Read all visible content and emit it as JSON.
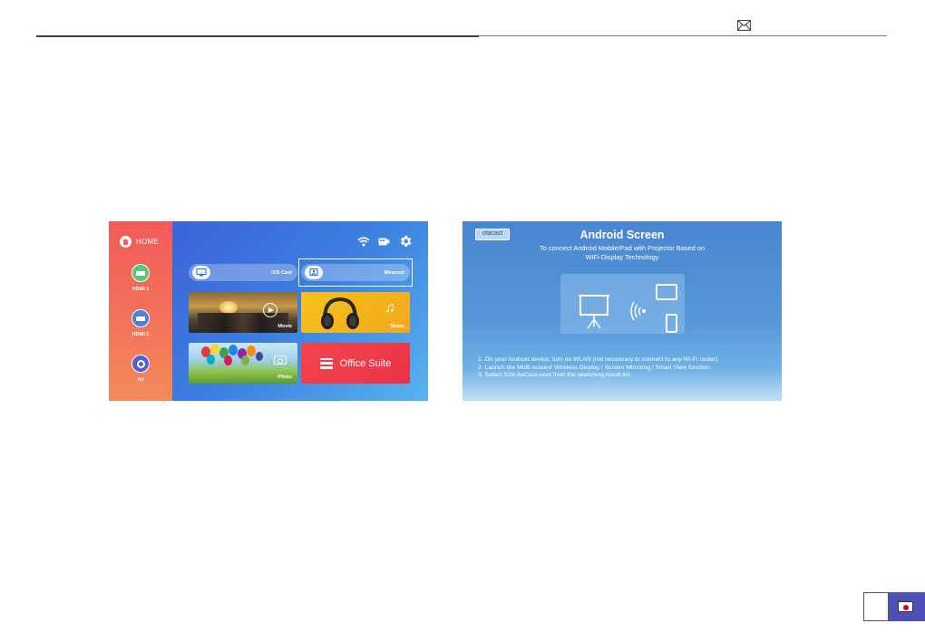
{
  "header": {
    "mail_icon": "mail-icon",
    "rule_color": "#6a6fc9"
  },
  "launcher": {
    "home_label": "HOME",
    "sources": [
      {
        "label": "HDMI 1",
        "icon": "hdmi-icon",
        "color": "#5cc37a"
      },
      {
        "label": "HDMI 2",
        "icon": "hdmi-icon",
        "color": "#4d7ee0"
      },
      {
        "label": "AV",
        "icon": "av-icon",
        "color": "#4d62d6"
      }
    ],
    "status_icons": [
      "wifi-icon",
      "usb-icon",
      "gear-icon"
    ],
    "cast_buttons": [
      {
        "label": "iOS Cast",
        "icon": "airplay-icon"
      },
      {
        "label": "Miracast",
        "icon": "miracast-icon",
        "focused": true
      }
    ],
    "tiles": [
      {
        "label": "Movie",
        "icon": "play-icon"
      },
      {
        "label": "Music",
        "icon": "music-note-icon"
      },
      {
        "label": "Photo",
        "icon": "camera-icon"
      },
      {
        "label": "Office Suite",
        "icon": "document-list-icon"
      }
    ]
  },
  "android_screen": {
    "brand": "otacast",
    "title": "Android Screen",
    "subtitle_lines": [
      "To connect Android Mobile/Pad with Projector Based on",
      "WiFi-Display Technology"
    ],
    "steps": [
      "1. On your Android device, turn on WLAN (not necessary to connect to any Wi-Fi router)",
      "2. Launch the Multi-screen/ Wireless Display / Screen Mirroring / Smart View function",
      "3. Select S28-AeCast-xxxx from the searching result list."
    ]
  },
  "footer": {
    "flag_icon": "japan-flag-icon",
    "tab_color": "#4f4fb8"
  }
}
